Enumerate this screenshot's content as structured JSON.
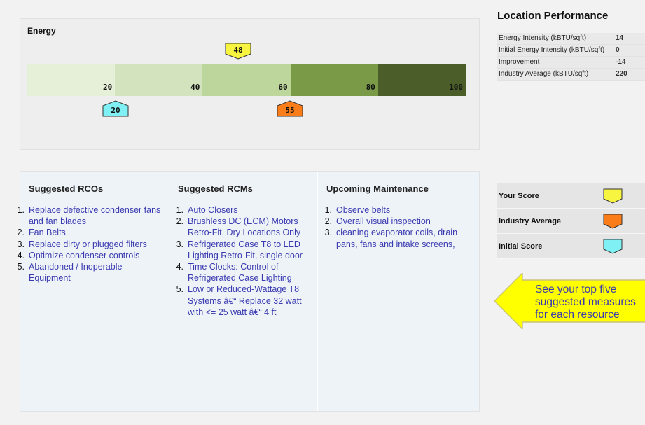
{
  "energy": {
    "title": "Energy",
    "ticks": [
      "20",
      "40",
      "60",
      "80",
      "100"
    ],
    "segment_colors": [
      "#e6efd8",
      "#d2e3bd",
      "#bdd69b",
      "#7a9a48",
      "#4b5e2a"
    ],
    "markers": {
      "your_score": {
        "label": "48",
        "color": "#f7f540"
      },
      "initial_score": {
        "label": "20",
        "color": "#7ff0f4"
      },
      "industry_average": {
        "label": "55",
        "color": "#fa7d1a"
      }
    }
  },
  "suggested_rcos": {
    "heading": "Suggested RCOs",
    "items": [
      {
        "num": "1.",
        "text": "Replace defective condenser fans and fan blades"
      },
      {
        "num": "2.",
        "text": "Fan Belts"
      },
      {
        "num": "3.",
        "text": "Replace dirty or plugged filters"
      },
      {
        "num": "4.",
        "text": "Optimize condenser controls"
      },
      {
        "num": "5.",
        "text": "Abandoned / Inoperable Equipment"
      }
    ]
  },
  "suggested_rcms": {
    "heading": "Suggested RCMs",
    "items": [
      {
        "num": "1.",
        "text": "Auto Closers"
      },
      {
        "num": "2.",
        "text": "Brushless DC (ECM) Motors Retro-Fit, Dry Locations Only"
      },
      {
        "num": "3.",
        "text": "Refrigerated Case T8 to LED Lighting Retro-Fit, single door"
      },
      {
        "num": "4.",
        "text": "Time Clocks: Control of Refrigerated Case Lighting"
      },
      {
        "num": "5.",
        "text": "Low or Reduced-Wattage T8 Systems â€“ Replace 32 watt with <= 25 watt â€“ 4 ft"
      }
    ]
  },
  "upcoming_maintenance": {
    "heading": "Upcoming Maintenance",
    "items": [
      {
        "num": "1.",
        "text": "Observe belts"
      },
      {
        "num": "2.",
        "text": "Overall visual inspection"
      },
      {
        "num": "3.",
        "text": "cleaning evaporator coils, drain pans, fans and intake screens,"
      }
    ]
  },
  "location_performance": {
    "title": "Location Performance",
    "rows": [
      {
        "label": "Energy Intensity (kBTU/sqft)",
        "value": "14"
      },
      {
        "label": "Initial Energy Intensity (kBTU/sqft)",
        "value": "0"
      },
      {
        "label": "Improvement",
        "value": "-14"
      },
      {
        "label": "Industry Average (kBTU/sqft)",
        "value": "220"
      }
    ]
  },
  "legend": {
    "rows": [
      {
        "label": "Your Score",
        "color": "#f7f540"
      },
      {
        "label": "Industry Average",
        "color": "#fa7d1a"
      },
      {
        "label": "Initial Score",
        "color": "#7ff0f4"
      }
    ]
  },
  "callout": {
    "lines": [
      "See your top five",
      "suggested measures",
      "for each resource"
    ],
    "color": "#ffff00"
  }
}
